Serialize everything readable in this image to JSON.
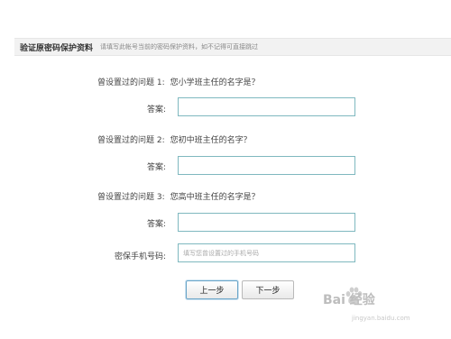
{
  "header": {
    "title": "验证原密码保护资料",
    "hint": "请填写此帐号当前的密码保护资料，如不记得可直接跳过"
  },
  "questions": [
    {
      "label": "曾设置过的问题 1:",
      "text": "您小学班主任的名字是？",
      "answer_label": "答案:",
      "answer_value": ""
    },
    {
      "label": "曾设置过的问题 2:",
      "text": "您初中班主任的名字？",
      "answer_label": "答案:",
      "answer_value": ""
    },
    {
      "label": "曾设置过的问题 3:",
      "text": "您高中班主任的名字是？",
      "answer_label": "答案:",
      "answer_value": ""
    }
  ],
  "phone": {
    "label": "密保手机号码:",
    "placeholder": "填写您曾设置过的手机号码",
    "value": ""
  },
  "buttons": {
    "prev": "上一步",
    "next": "下一步"
  },
  "watermark": {
    "brand": "Bai 经验",
    "url": "jingyan.baidu.com"
  }
}
